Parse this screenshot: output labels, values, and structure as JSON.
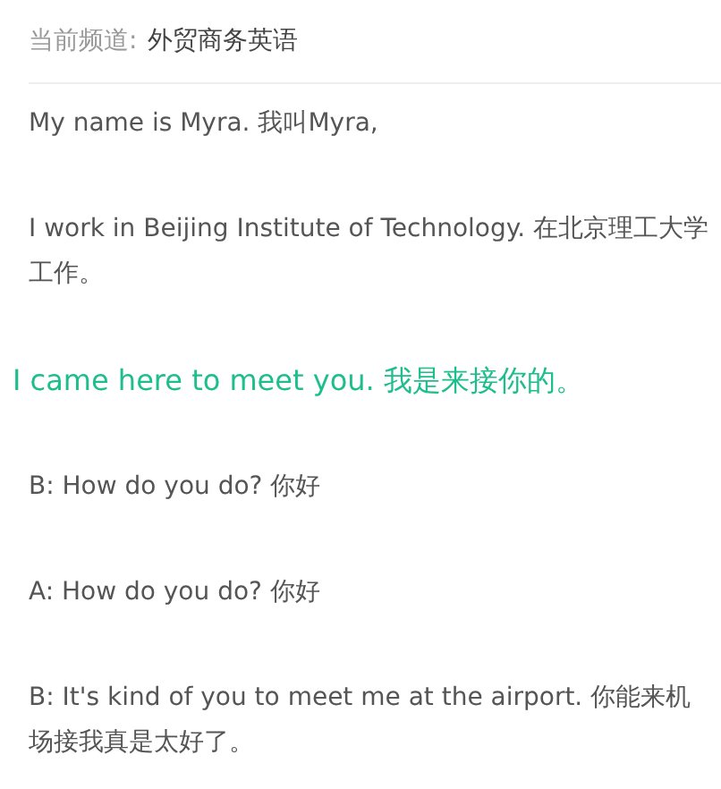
{
  "channel": {
    "label": "当前频道:",
    "name": "外贸商务英语"
  },
  "lines": [
    {
      "text": "My name is Myra. 我叫Myra,",
      "selected": false
    },
    {
      "text": "I work in Beijing Institute of Technology. 在北京理工大学工作。",
      "selected": false
    },
    {
      "text": "I came here to meet you. 我是来接你的。",
      "selected": true
    },
    {
      "text": "B: How do you do? 你好",
      "selected": false
    },
    {
      "text": "A: How do you do? 你好",
      "selected": false
    },
    {
      "text": "B: It's kind of you to meet me at the airport. 你能来机场接我真是太好了。",
      "selected": false
    }
  ]
}
